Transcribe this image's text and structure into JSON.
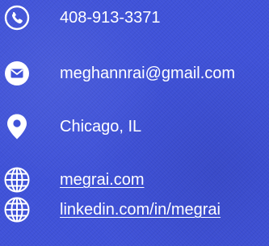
{
  "contacts": {
    "phone": {
      "icon": "phone-icon",
      "text": "408-913-3371"
    },
    "email": {
      "icon": "envelope-icon",
      "text": "meghannrai@gmail.com"
    },
    "location": {
      "icon": "map-pin-icon",
      "text": "Chicago, IL"
    },
    "website": {
      "icon": "globe-icon",
      "text": "megrai.com"
    },
    "linkedin": {
      "icon": "globe-icon",
      "text": "linkedin.com/in/megrai"
    }
  },
  "colors": {
    "background": "#3f52d9",
    "foreground": "#ffffff"
  }
}
